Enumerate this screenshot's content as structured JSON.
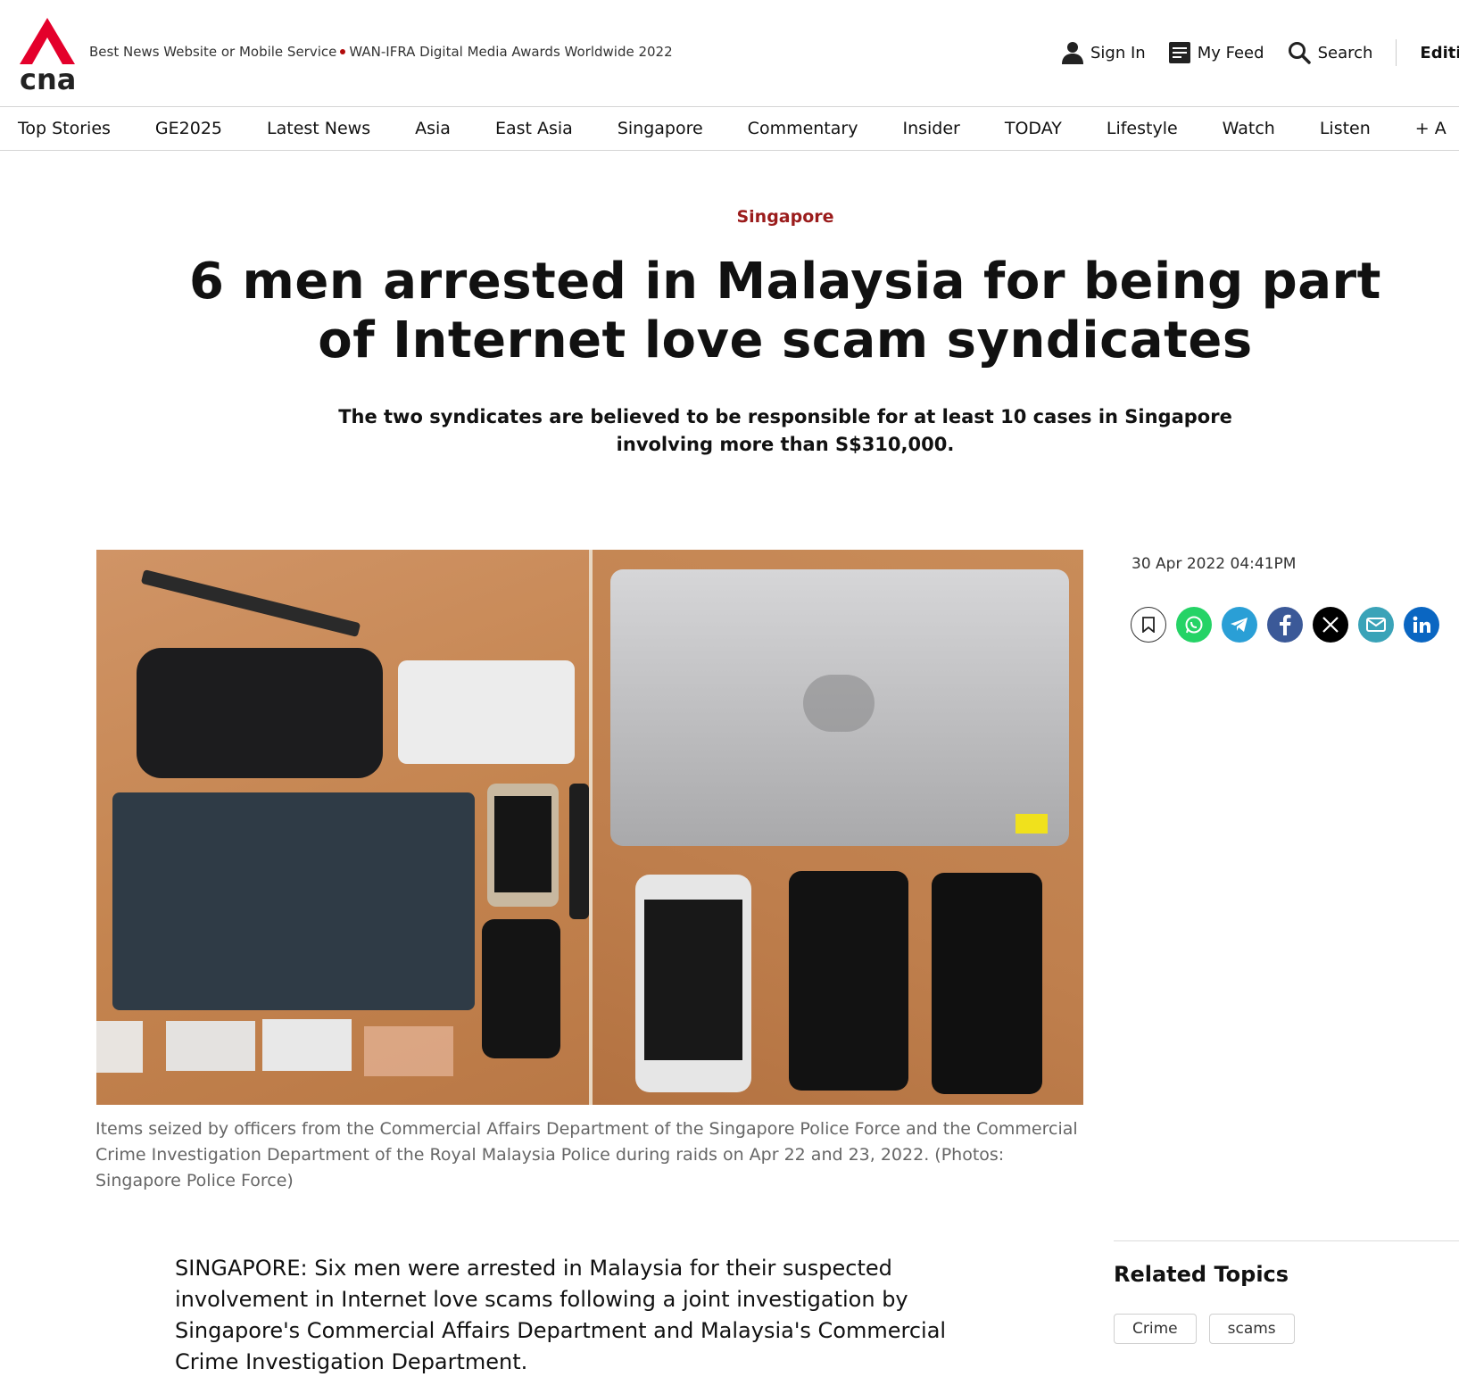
{
  "header": {
    "award_part1": "Best News Website or Mobile Service",
    "award_part2": "WAN-IFRA Digital Media Awards Worldwide 2022",
    "sign_in": "Sign In",
    "my_feed": "My Feed",
    "search": "Search",
    "edition": "Editi",
    "logo_text": "cna"
  },
  "nav": {
    "items": [
      "Top Stories",
      "GE2025",
      "Latest News",
      "Asia",
      "East Asia",
      "Singapore",
      "Commentary",
      "Insider",
      "TODAY",
      "Lifestyle",
      "Watch",
      "Listen",
      "+ A"
    ]
  },
  "article": {
    "section": "Singapore",
    "headline": "6 men arrested in Malaysia for being part of Internet love scam syndicates",
    "standfirst": "The two syndicates are believed to be responsible for at least 10 cases in Singapore involving more than S$310,000.",
    "caption": "Items seized by officers from the Commercial Affairs Department of the Singapore Police Force and the Commercial Crime Investigation Department of the Royal Malaysia Police during raids on Apr 22 and 23, 2022. (Photos: Singapore Police Force)",
    "body": "SINGAPORE: Six men were arrested in Malaysia for their suspected involvement in Internet love scams following a joint investigation by Singapore's Commercial Affairs Department and Malaysia's Commercial Crime Investigation Department."
  },
  "sidebar": {
    "timestamp": "30 Apr 2022 04:41PM",
    "related_title": "Related Topics",
    "tags": [
      "Crime",
      "scams"
    ]
  },
  "colors": {
    "brand_red": "#e4002b",
    "section_red": "#9b1c1c",
    "whatsapp": "#25d366",
    "telegram": "#2a9fd6",
    "facebook": "#3b5998",
    "x": "#000000",
    "email": "#3aa3b8",
    "linkedin": "#0a66c2"
  }
}
